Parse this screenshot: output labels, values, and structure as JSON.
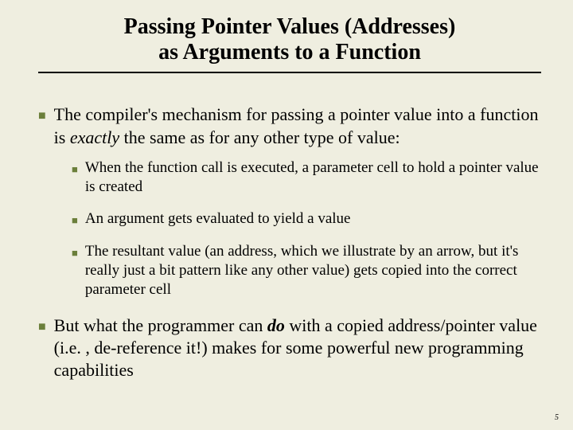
{
  "title_line1": "Passing Pointer Values (Addresses)",
  "title_line2": "as Arguments to a Function",
  "p1_a": "The compiler's mechanism for passing a pointer value into a function is ",
  "p1_em": "exactly",
  "p1_b": " the same as for any other type of value:",
  "sub1": "When the function call is executed, a parameter cell to hold a pointer value is created",
  "sub2": "An argument gets evaluated to yield a value",
  "sub3": "The resultant value (an address, which we illustrate by an arrow, but it's really just a bit pattern like any other value) gets copied into the correct parameter cell",
  "p2_a": "But what the programmer can ",
  "p2_bi": "do",
  "p2_b": " with a copied address/pointer value (i.e. , de-reference it!) makes for some powerful new programming capabilities",
  "pagenum": "5"
}
